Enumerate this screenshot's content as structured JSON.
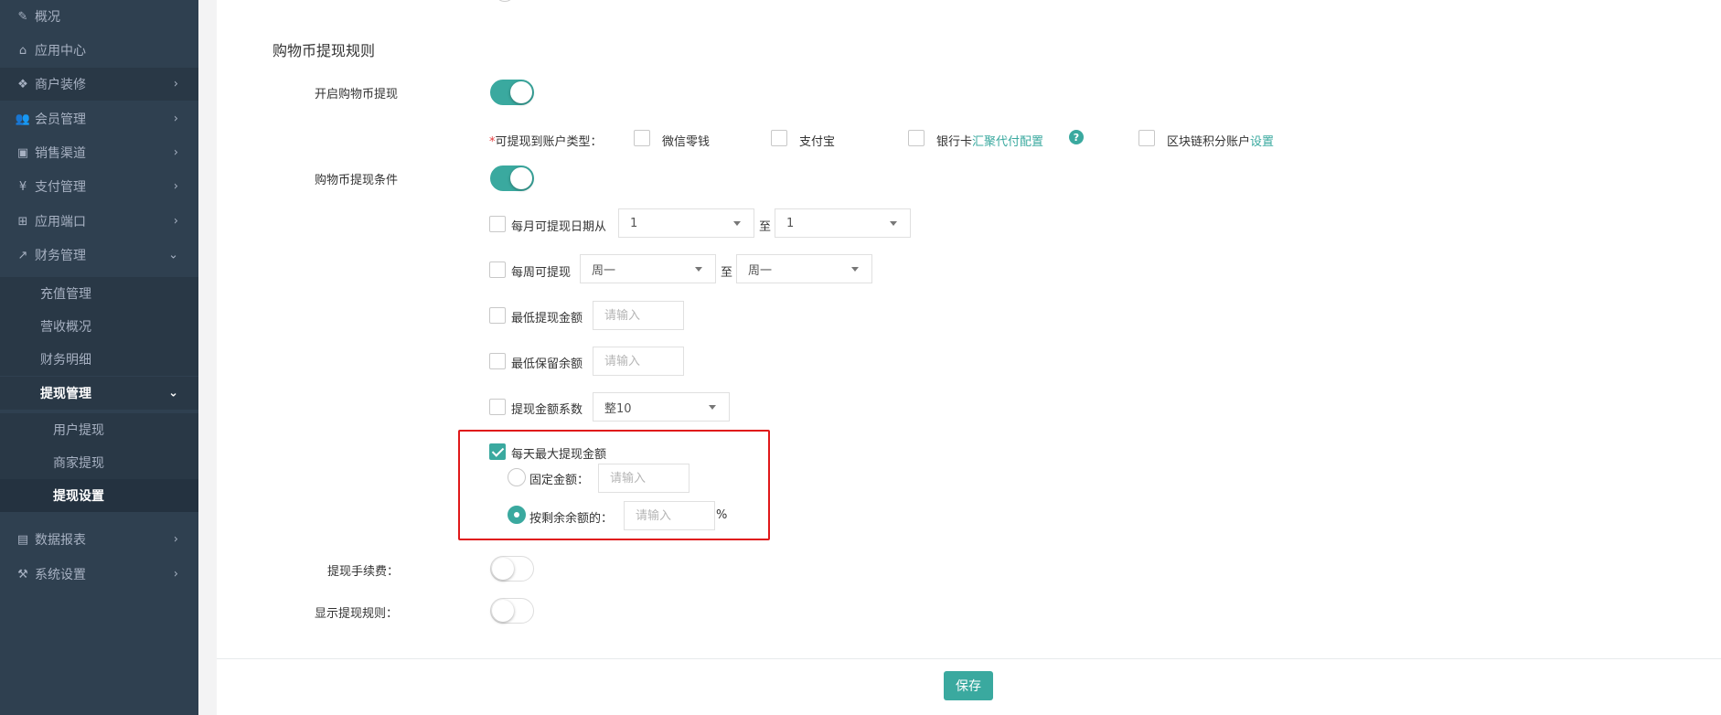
{
  "sidebar": {
    "items": [
      {
        "label": "概况",
        "icon": "edit-icon",
        "glyph": "✎",
        "chevron": ""
      },
      {
        "label": "应用中心",
        "icon": "home-icon",
        "glyph": "⌂",
        "chevron": ""
      },
      {
        "label": "商户装修",
        "icon": "cubes-icon",
        "glyph": "❖",
        "chevron": "›"
      },
      {
        "label": "会员管理",
        "icon": "users-icon",
        "glyph": "👥",
        "chevron": "›"
      },
      {
        "label": "销售渠道",
        "icon": "money-icon",
        "glyph": "▣",
        "chevron": "›"
      },
      {
        "label": "支付管理",
        "icon": "yen-icon",
        "glyph": "¥",
        "chevron": "›"
      },
      {
        "label": "应用端口",
        "icon": "plug-icon",
        "glyph": "⊞",
        "chevron": "›"
      },
      {
        "label": "财务管理",
        "icon": "line-chart-icon",
        "glyph": "↗",
        "chevron": "⌄"
      }
    ],
    "finance_sub": [
      "充值管理",
      "营收概况",
      "财务明细"
    ],
    "withdraw_group": {
      "label": "提现管理",
      "chevron": "⌄"
    },
    "withdraw_sub": [
      "用户提现",
      "商家提现",
      "提现设置"
    ],
    "bottom_items": [
      {
        "label": "数据报表",
        "icon": "report-icon",
        "glyph": "▤",
        "chevron": "›"
      },
      {
        "label": "系统设置",
        "icon": "wrench-icon",
        "glyph": "⚒",
        "chevron": "›"
      }
    ]
  },
  "form": {
    "section_title": "购物币提现规则",
    "enable_label": "开启购物币提现",
    "account_type": {
      "required_mark": "*",
      "label": "可提现到账户类型：",
      "options": [
        "微信零钱",
        "支付宝",
        "银行卡",
        "区块链积分账户"
      ],
      "bank_link": "汇聚代付配置",
      "help_glyph": "?",
      "chain_link": "设置"
    },
    "conditions_label": "购物币提现条件",
    "monthly": {
      "label": "每月可提现日期从",
      "from": "1",
      "to_text": "至",
      "to": "1"
    },
    "weekly": {
      "label": "每周可提现",
      "from": "周一",
      "to_text": "至",
      "to": "周一"
    },
    "min_amount": {
      "label": "最低提现金额",
      "placeholder": "请输入"
    },
    "min_balance": {
      "label": "最低保留余额",
      "placeholder": "请输入"
    },
    "coefficient": {
      "label": "提现金额系数",
      "value": "整10"
    },
    "daily_max": {
      "label": "每天最大提现金额",
      "fixed_label": "固定金额：",
      "fixed_placeholder": "请输入",
      "percent_label": "按剩余余额的：",
      "percent_placeholder": "请输入",
      "percent_unit": "%"
    },
    "fee_label": "提现手续费：",
    "show_rules_label": "显示提现规则："
  },
  "footer": {
    "save_label": "保存"
  },
  "colors": {
    "accent": "#3aa99f",
    "sidebar": "#2f4050",
    "highlight": "#e0181a"
  }
}
